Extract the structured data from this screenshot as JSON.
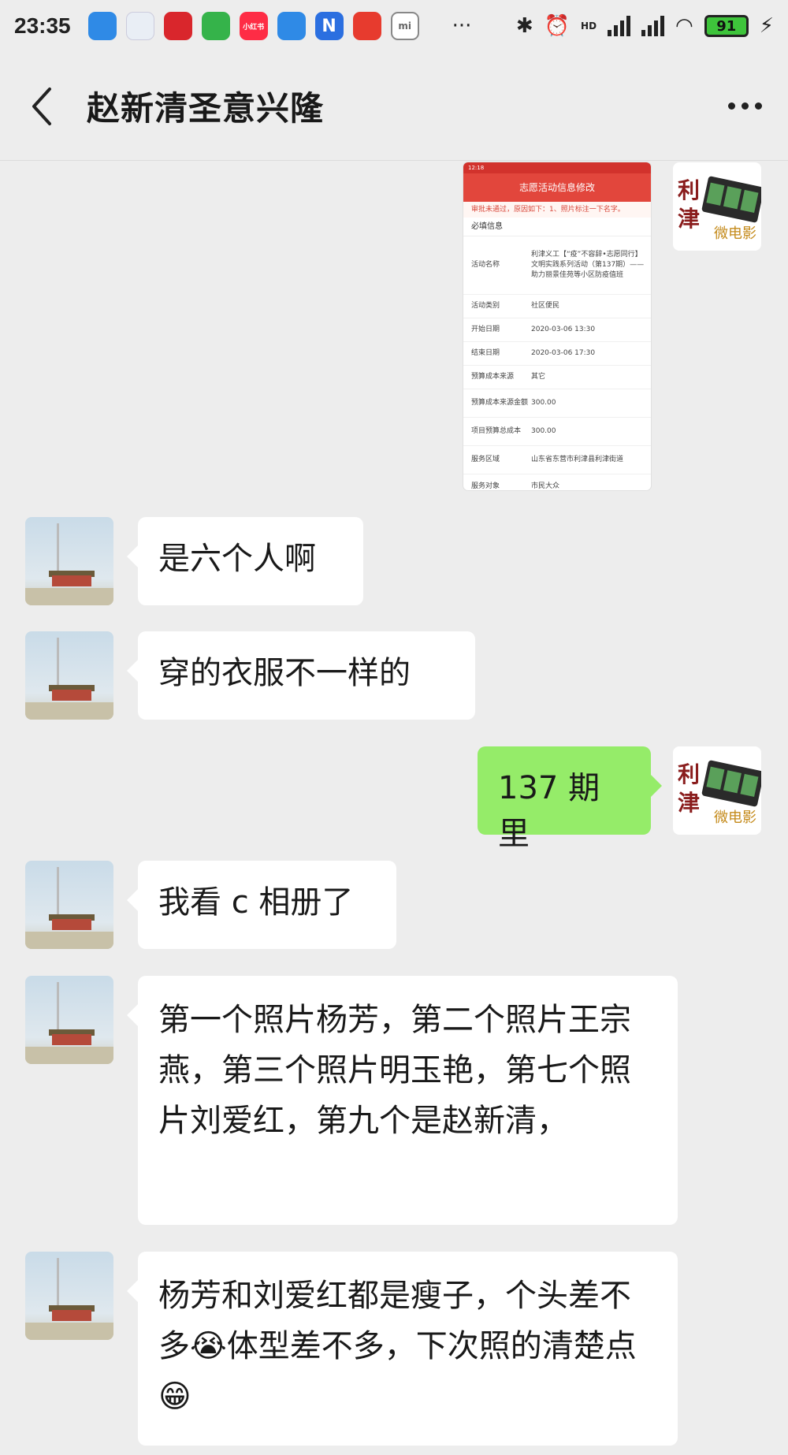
{
  "status_bar": {
    "time": "23:35",
    "battery": "91",
    "network": "HD",
    "apps": [
      {
        "name": "app-icon-blue",
        "color": "#2f8ae6"
      },
      {
        "name": "app-icon-gov",
        "color": "#e9eef5"
      },
      {
        "name": "app-icon-red-pattern",
        "color": "#d9262c"
      },
      {
        "name": "app-icon-video",
        "color": "#35b34a"
      },
      {
        "name": "app-icon-xiaohongshu",
        "color": "#fe2c45",
        "label": "小红书"
      },
      {
        "name": "app-icon-blue-2",
        "color": "#2f8ae6"
      },
      {
        "name": "app-icon-n",
        "color": "#2b6fe0",
        "label": "N"
      },
      {
        "name": "app-icon-red-bird",
        "color": "#e73b2e"
      },
      {
        "name": "app-icon-mi",
        "color": "#ffffff",
        "label": "mi"
      }
    ]
  },
  "header": {
    "title": "赵新清圣意兴隆"
  },
  "screenshot_message": {
    "status_time": "12:18",
    "title": "志愿活动信息修改",
    "notice": "审批未通过，原因如下：1、照片标注一下名字。",
    "section": "必填信息",
    "rows": [
      {
        "key": "活动名称",
        "value": "利津义工【“疫”不容辞•志愿同行】文明实践系列活动（第137期）——助力丽景佳苑等小区防疫值班"
      },
      {
        "key": "活动类别",
        "value": "社区便民"
      },
      {
        "key": "开始日期",
        "value": "2020-03-06 13:30"
      },
      {
        "key": "结束日期",
        "value": "2020-03-06 17:30"
      },
      {
        "key": "预算成本来源",
        "value": "其它"
      },
      {
        "key": "预算成本来源金额",
        "value": "300.00"
      },
      {
        "key": "项目预算总成本",
        "value": "300.00"
      },
      {
        "key": "服务区域",
        "value": "山东省东营市利津县利津街道"
      },
      {
        "key": "服务对象",
        "value": "市民大众"
      }
    ]
  },
  "my_avatar": {
    "char1": "利",
    "char2": "津",
    "sub": "微电影"
  },
  "messages": [
    {
      "text": "是六个人啊"
    },
    {
      "text": "穿的衣服不一样的"
    },
    {
      "text": "137 期里"
    },
    {
      "text": "我看 c 相册了"
    },
    {
      "text": "第一个照片杨芳，第二个照片王宗燕，第三个照片明玉艳，第七个照片刘爱红，第九个是赵新清，"
    },
    {
      "text": "杨芳和刘爱红都是瘦子，个头差不多😭体型差不多，下次照的清楚点😁"
    }
  ]
}
